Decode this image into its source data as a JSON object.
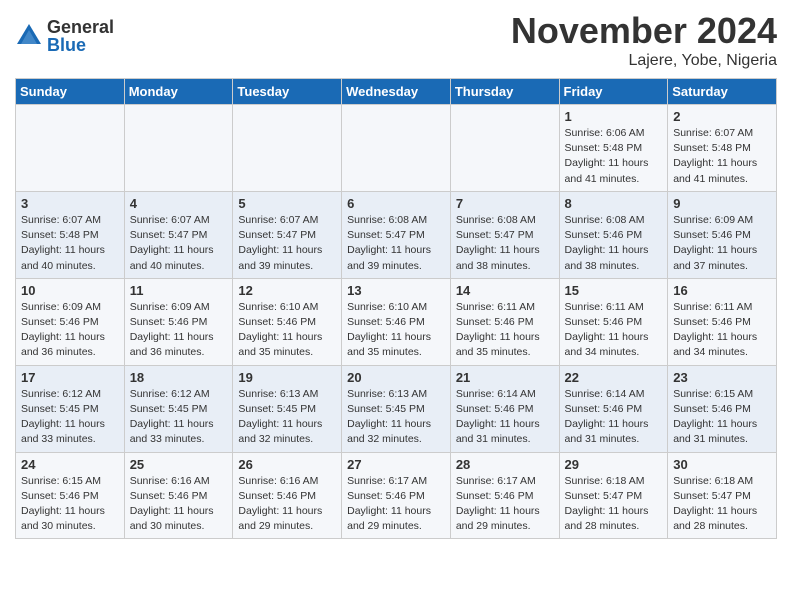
{
  "logo": {
    "general": "General",
    "blue": "Blue"
  },
  "header": {
    "month": "November 2024",
    "location": "Lajere, Yobe, Nigeria"
  },
  "days_of_week": [
    "Sunday",
    "Monday",
    "Tuesday",
    "Wednesday",
    "Thursday",
    "Friday",
    "Saturday"
  ],
  "weeks": [
    [
      {
        "day": "",
        "info": ""
      },
      {
        "day": "",
        "info": ""
      },
      {
        "day": "",
        "info": ""
      },
      {
        "day": "",
        "info": ""
      },
      {
        "day": "",
        "info": ""
      },
      {
        "day": "1",
        "info": "Sunrise: 6:06 AM\nSunset: 5:48 PM\nDaylight: 11 hours and 41 minutes."
      },
      {
        "day": "2",
        "info": "Sunrise: 6:07 AM\nSunset: 5:48 PM\nDaylight: 11 hours and 41 minutes."
      }
    ],
    [
      {
        "day": "3",
        "info": "Sunrise: 6:07 AM\nSunset: 5:48 PM\nDaylight: 11 hours and 40 minutes."
      },
      {
        "day": "4",
        "info": "Sunrise: 6:07 AM\nSunset: 5:47 PM\nDaylight: 11 hours and 40 minutes."
      },
      {
        "day": "5",
        "info": "Sunrise: 6:07 AM\nSunset: 5:47 PM\nDaylight: 11 hours and 39 minutes."
      },
      {
        "day": "6",
        "info": "Sunrise: 6:08 AM\nSunset: 5:47 PM\nDaylight: 11 hours and 39 minutes."
      },
      {
        "day": "7",
        "info": "Sunrise: 6:08 AM\nSunset: 5:47 PM\nDaylight: 11 hours and 38 minutes."
      },
      {
        "day": "8",
        "info": "Sunrise: 6:08 AM\nSunset: 5:46 PM\nDaylight: 11 hours and 38 minutes."
      },
      {
        "day": "9",
        "info": "Sunrise: 6:09 AM\nSunset: 5:46 PM\nDaylight: 11 hours and 37 minutes."
      }
    ],
    [
      {
        "day": "10",
        "info": "Sunrise: 6:09 AM\nSunset: 5:46 PM\nDaylight: 11 hours and 36 minutes."
      },
      {
        "day": "11",
        "info": "Sunrise: 6:09 AM\nSunset: 5:46 PM\nDaylight: 11 hours and 36 minutes."
      },
      {
        "day": "12",
        "info": "Sunrise: 6:10 AM\nSunset: 5:46 PM\nDaylight: 11 hours and 35 minutes."
      },
      {
        "day": "13",
        "info": "Sunrise: 6:10 AM\nSunset: 5:46 PM\nDaylight: 11 hours and 35 minutes."
      },
      {
        "day": "14",
        "info": "Sunrise: 6:11 AM\nSunset: 5:46 PM\nDaylight: 11 hours and 35 minutes."
      },
      {
        "day": "15",
        "info": "Sunrise: 6:11 AM\nSunset: 5:46 PM\nDaylight: 11 hours and 34 minutes."
      },
      {
        "day": "16",
        "info": "Sunrise: 6:11 AM\nSunset: 5:46 PM\nDaylight: 11 hours and 34 minutes."
      }
    ],
    [
      {
        "day": "17",
        "info": "Sunrise: 6:12 AM\nSunset: 5:45 PM\nDaylight: 11 hours and 33 minutes."
      },
      {
        "day": "18",
        "info": "Sunrise: 6:12 AM\nSunset: 5:45 PM\nDaylight: 11 hours and 33 minutes."
      },
      {
        "day": "19",
        "info": "Sunrise: 6:13 AM\nSunset: 5:45 PM\nDaylight: 11 hours and 32 minutes."
      },
      {
        "day": "20",
        "info": "Sunrise: 6:13 AM\nSunset: 5:45 PM\nDaylight: 11 hours and 32 minutes."
      },
      {
        "day": "21",
        "info": "Sunrise: 6:14 AM\nSunset: 5:46 PM\nDaylight: 11 hours and 31 minutes."
      },
      {
        "day": "22",
        "info": "Sunrise: 6:14 AM\nSunset: 5:46 PM\nDaylight: 11 hours and 31 minutes."
      },
      {
        "day": "23",
        "info": "Sunrise: 6:15 AM\nSunset: 5:46 PM\nDaylight: 11 hours and 31 minutes."
      }
    ],
    [
      {
        "day": "24",
        "info": "Sunrise: 6:15 AM\nSunset: 5:46 PM\nDaylight: 11 hours and 30 minutes."
      },
      {
        "day": "25",
        "info": "Sunrise: 6:16 AM\nSunset: 5:46 PM\nDaylight: 11 hours and 30 minutes."
      },
      {
        "day": "26",
        "info": "Sunrise: 6:16 AM\nSunset: 5:46 PM\nDaylight: 11 hours and 29 minutes."
      },
      {
        "day": "27",
        "info": "Sunrise: 6:17 AM\nSunset: 5:46 PM\nDaylight: 11 hours and 29 minutes."
      },
      {
        "day": "28",
        "info": "Sunrise: 6:17 AM\nSunset: 5:46 PM\nDaylight: 11 hours and 29 minutes."
      },
      {
        "day": "29",
        "info": "Sunrise: 6:18 AM\nSunset: 5:47 PM\nDaylight: 11 hours and 28 minutes."
      },
      {
        "day": "30",
        "info": "Sunrise: 6:18 AM\nSunset: 5:47 PM\nDaylight: 11 hours and 28 minutes."
      }
    ]
  ]
}
